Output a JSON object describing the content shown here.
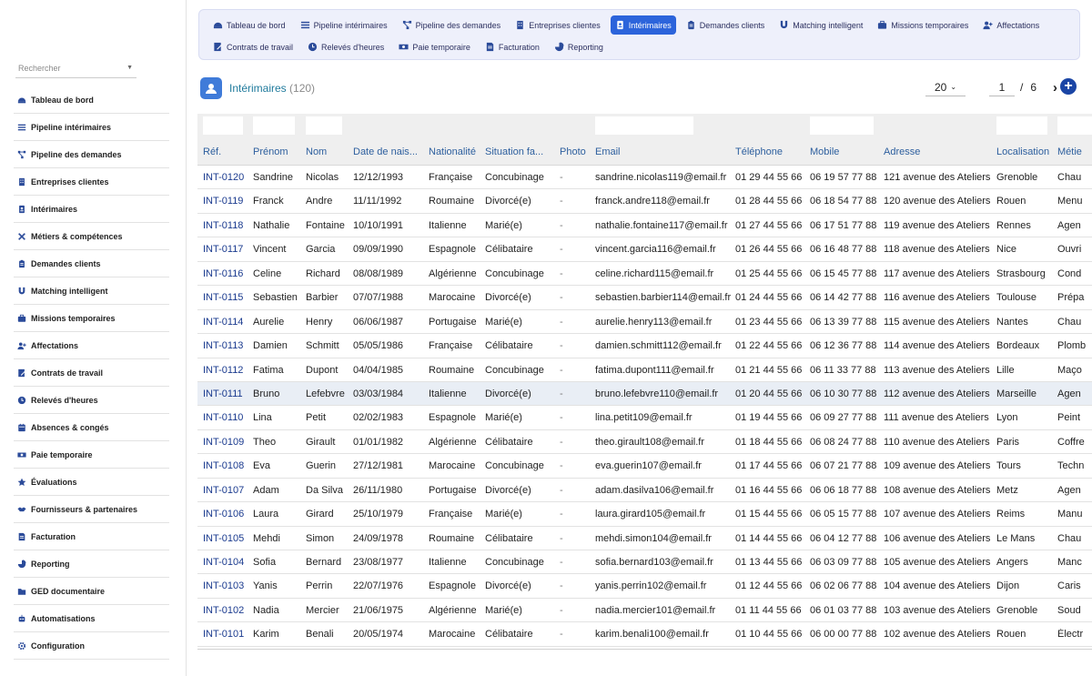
{
  "sidebar": {
    "search_placeholder": "Rechercher",
    "items": [
      {
        "label": "Tableau de bord",
        "icon": "dashboard-icon"
      },
      {
        "label": "Pipeline intérimaires",
        "icon": "list-icon"
      },
      {
        "label": "Pipeline des demandes",
        "icon": "flow-icon"
      },
      {
        "label": "Entreprises clientes",
        "icon": "building-icon"
      },
      {
        "label": "Intérimaires",
        "icon": "badge-icon"
      },
      {
        "label": "Métiers & compétences",
        "icon": "tools-icon"
      },
      {
        "label": "Demandes clients",
        "icon": "clipboard-icon"
      },
      {
        "label": "Matching intelligent",
        "icon": "magnet-icon"
      },
      {
        "label": "Missions temporaires",
        "icon": "briefcase-icon"
      },
      {
        "label": "Affectations",
        "icon": "user-plus-icon"
      },
      {
        "label": "Contrats de travail",
        "icon": "contract-icon"
      },
      {
        "label": "Relevés d'heures",
        "icon": "clock-icon"
      },
      {
        "label": "Absences & congés",
        "icon": "calendar-icon"
      },
      {
        "label": "Paie temporaire",
        "icon": "money-icon"
      },
      {
        "label": "Évaluations",
        "icon": "star-icon"
      },
      {
        "label": "Fournisseurs & partenaires",
        "icon": "handshake-icon"
      },
      {
        "label": "Facturation",
        "icon": "invoice-icon"
      },
      {
        "label": "Reporting",
        "icon": "pie-icon"
      },
      {
        "label": "GED documentaire",
        "icon": "folder-icon"
      },
      {
        "label": "Automatisations",
        "icon": "robot-icon"
      },
      {
        "label": "Configuration",
        "icon": "gear-icon"
      }
    ]
  },
  "topnav": {
    "row1": [
      {
        "label": "Tableau de bord",
        "icon": "dashboard-icon"
      },
      {
        "label": "Pipeline intérimaires",
        "icon": "list-icon"
      },
      {
        "label": "Pipeline des demandes",
        "icon": "flow-icon"
      },
      {
        "label": "Entreprises clientes",
        "icon": "building-icon"
      },
      {
        "label": "Intérimaires",
        "icon": "badge-icon",
        "active": true
      },
      {
        "label": "Demandes clients",
        "icon": "clipboard-icon"
      },
      {
        "label": "Matching intelligent",
        "icon": "magnet-icon"
      },
      {
        "label": "Missions temporaires",
        "icon": "briefcase-icon"
      },
      {
        "label": "Affectations",
        "icon": "user-plus-icon"
      }
    ],
    "row2": [
      {
        "label": "Contrats de travail",
        "icon": "contract-icon"
      },
      {
        "label": "Relevés d'heures",
        "icon": "clock-icon"
      },
      {
        "label": "Paie temporaire",
        "icon": "money-icon"
      },
      {
        "label": "Facturation",
        "icon": "invoice-icon"
      },
      {
        "label": "Reporting",
        "icon": "pie-icon"
      }
    ]
  },
  "header": {
    "title": "Intérimaires",
    "count": "(120)",
    "icon": "contact-card-icon"
  },
  "pager": {
    "page_size": "20",
    "current_page": "1",
    "separator": "/",
    "total_pages": "6",
    "next_icon": "chevron-right-icon",
    "add_icon": "plus-circle-icon"
  },
  "colors": {
    "accent": "#2c64db",
    "link": "#1b3b8f",
    "header_text": "#2d5f9e",
    "title": "#1f7a9c",
    "add_button": "#1a45a5",
    "nav_bg": "#eef0fb"
  },
  "table": {
    "columns": [
      "Réf.",
      "Prénom",
      "Nom",
      "Date de nais...",
      "Nationalité",
      "Situation fa...",
      "Photo",
      "Email",
      "Téléphone",
      "Mobile",
      "Adresse",
      "Localisation",
      "Métie"
    ],
    "highlight_row": 9,
    "rows": [
      [
        "INT-0120",
        "Sandrine",
        "Nicolas",
        "12/12/1993",
        "Française",
        "Concubinage",
        "-",
        "sandrine.nicolas119@email.fr",
        "01 29 44 55 66",
        "06 19 57 77 88",
        "121 avenue des Ateliers",
        "Grenoble",
        "Chau"
      ],
      [
        "INT-0119",
        "Franck",
        "Andre",
        "11/11/1992",
        "Roumaine",
        "Divorcé(e)",
        "-",
        "franck.andre118@email.fr",
        "01 28 44 55 66",
        "06 18 54 77 88",
        "120 avenue des Ateliers",
        "Rouen",
        "Menu"
      ],
      [
        "INT-0118",
        "Nathalie",
        "Fontaine",
        "10/10/1991",
        "Italienne",
        "Marié(e)",
        "-",
        "nathalie.fontaine117@email.fr",
        "01 27 44 55 66",
        "06 17 51 77 88",
        "119 avenue des Ateliers",
        "Rennes",
        "Agen"
      ],
      [
        "INT-0117",
        "Vincent",
        "Garcia",
        "09/09/1990",
        "Espagnole",
        "Célibataire",
        "-",
        "vincent.garcia116@email.fr",
        "01 26 44 55 66",
        "06 16 48 77 88",
        "118 avenue des Ateliers",
        "Nice",
        "Ouvri"
      ],
      [
        "INT-0116",
        "Celine",
        "Richard",
        "08/08/1989",
        "Algérienne",
        "Concubinage",
        "-",
        "celine.richard115@email.fr",
        "01 25 44 55 66",
        "06 15 45 77 88",
        "117 avenue des Ateliers",
        "Strasbourg",
        "Cond"
      ],
      [
        "INT-0115",
        "Sebastien",
        "Barbier",
        "07/07/1988",
        "Marocaine",
        "Divorcé(e)",
        "-",
        "sebastien.barbier114@email.fr",
        "01 24 44 55 66",
        "06 14 42 77 88",
        "116 avenue des Ateliers",
        "Toulouse",
        "Prépa"
      ],
      [
        "INT-0114",
        "Aurelie",
        "Henry",
        "06/06/1987",
        "Portugaise",
        "Marié(e)",
        "-",
        "aurelie.henry113@email.fr",
        "01 23 44 55 66",
        "06 13 39 77 88",
        "115 avenue des Ateliers",
        "Nantes",
        "Chau"
      ],
      [
        "INT-0113",
        "Damien",
        "Schmitt",
        "05/05/1986",
        "Française",
        "Célibataire",
        "-",
        "damien.schmitt112@email.fr",
        "01 22 44 55 66",
        "06 12 36 77 88",
        "114 avenue des Ateliers",
        "Bordeaux",
        "Plomb"
      ],
      [
        "INT-0112",
        "Fatima",
        "Dupont",
        "04/04/1985",
        "Roumaine",
        "Concubinage",
        "-",
        "fatima.dupont111@email.fr",
        "01 21 44 55 66",
        "06 11 33 77 88",
        "113 avenue des Ateliers",
        "Lille",
        "Maço"
      ],
      [
        "INT-0111",
        "Bruno",
        "Lefebvre",
        "03/03/1984",
        "Italienne",
        "Divorcé(e)",
        "-",
        "bruno.lefebvre110@email.fr",
        "01 20 44 55 66",
        "06 10 30 77 88",
        "112 avenue des Ateliers",
        "Marseille",
        "Agen"
      ],
      [
        "INT-0110",
        "Lina",
        "Petit",
        "02/02/1983",
        "Espagnole",
        "Marié(e)",
        "-",
        "lina.petit109@email.fr",
        "01 19 44 55 66",
        "06 09 27 77 88",
        "111 avenue des Ateliers",
        "Lyon",
        "Peint"
      ],
      [
        "INT-0109",
        "Theo",
        "Girault",
        "01/01/1982",
        "Algérienne",
        "Célibataire",
        "-",
        "theo.girault108@email.fr",
        "01 18 44 55 66",
        "06 08 24 77 88",
        "110 avenue des Ateliers",
        "Paris",
        "Coffre"
      ],
      [
        "INT-0108",
        "Eva",
        "Guerin",
        "27/12/1981",
        "Marocaine",
        "Concubinage",
        "-",
        "eva.guerin107@email.fr",
        "01 17 44 55 66",
        "06 07 21 77 88",
        "109 avenue des Ateliers",
        "Tours",
        "Techn"
      ],
      [
        "INT-0107",
        "Adam",
        "Da Silva",
        "26/11/1980",
        "Portugaise",
        "Divorcé(e)",
        "-",
        "adam.dasilva106@email.fr",
        "01 16 44 55 66",
        "06 06 18 77 88",
        "108 avenue des Ateliers",
        "Metz",
        "Agen"
      ],
      [
        "INT-0106",
        "Laura",
        "Girard",
        "25/10/1979",
        "Française",
        "Marié(e)",
        "-",
        "laura.girard105@email.fr",
        "01 15 44 55 66",
        "06 05 15 77 88",
        "107 avenue des Ateliers",
        "Reims",
        "Manu"
      ],
      [
        "INT-0105",
        "Mehdi",
        "Simon",
        "24/09/1978",
        "Roumaine",
        "Célibataire",
        "-",
        "mehdi.simon104@email.fr",
        "01 14 44 55 66",
        "06 04 12 77 88",
        "106 avenue des Ateliers",
        "Le Mans",
        "Chau"
      ],
      [
        "INT-0104",
        "Sofia",
        "Bernard",
        "23/08/1977",
        "Italienne",
        "Concubinage",
        "-",
        "sofia.bernard103@email.fr",
        "01 13 44 55 66",
        "06 03 09 77 88",
        "105 avenue des Ateliers",
        "Angers",
        "Manc"
      ],
      [
        "INT-0103",
        "Yanis",
        "Perrin",
        "22/07/1976",
        "Espagnole",
        "Divorcé(e)",
        "-",
        "yanis.perrin102@email.fr",
        "01 12 44 55 66",
        "06 02 06 77 88",
        "104 avenue des Ateliers",
        "Dijon",
        "Caris"
      ],
      [
        "INT-0102",
        "Nadia",
        "Mercier",
        "21/06/1975",
        "Algérienne",
        "Marié(e)",
        "-",
        "nadia.mercier101@email.fr",
        "01 11 44 55 66",
        "06 01 03 77 88",
        "103 avenue des Ateliers",
        "Grenoble",
        "Soud"
      ],
      [
        "INT-0101",
        "Karim",
        "Benali",
        "20/05/1974",
        "Marocaine",
        "Célibataire",
        "-",
        "karim.benali100@email.fr",
        "01 10 44 55 66",
        "06 00 00 77 88",
        "102 avenue des Ateliers",
        "Rouen",
        "Électr"
      ]
    ]
  }
}
